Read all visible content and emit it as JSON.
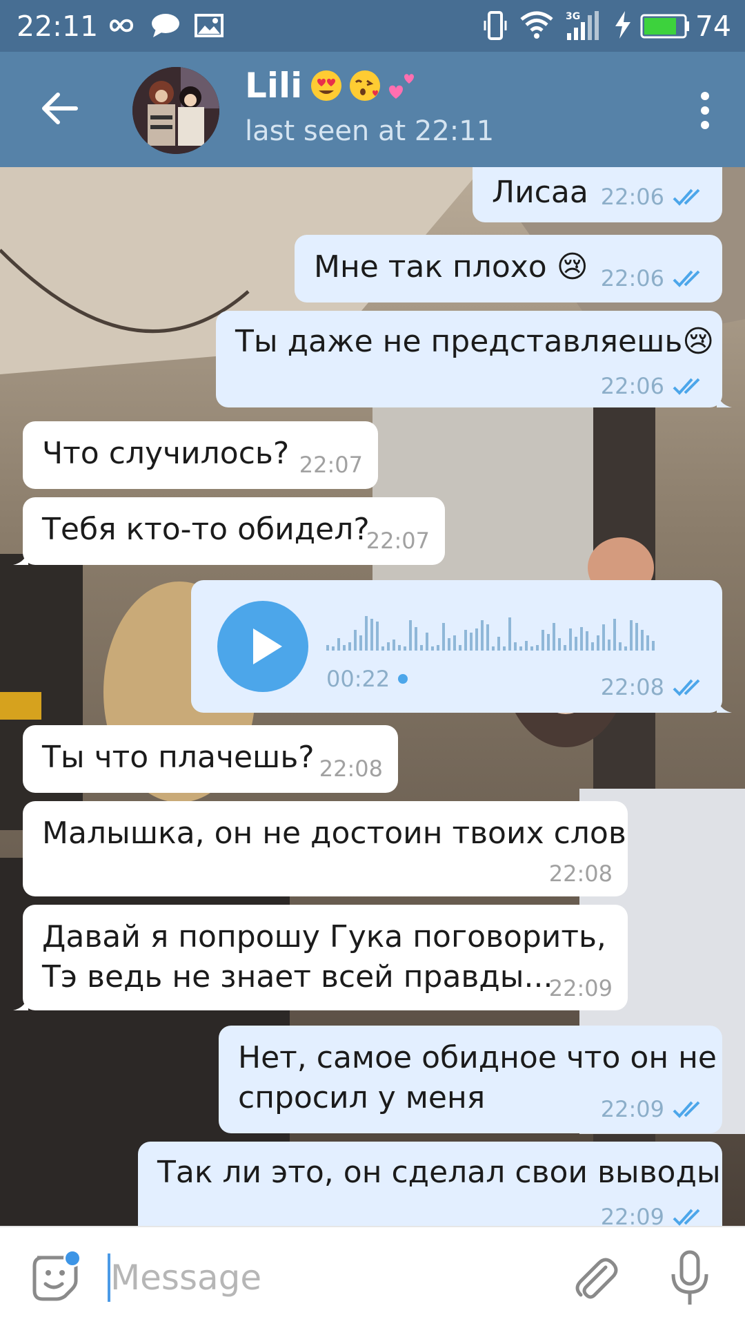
{
  "status_bar": {
    "time": "22:11",
    "battery": "74",
    "network": "3G"
  },
  "header": {
    "name": "Lili",
    "name_emojis": "😍😘💕",
    "status": "last seen at 22:11"
  },
  "messages": [
    {
      "dir": "out",
      "text": "Лисаа",
      "time": "22:06",
      "read": true
    },
    {
      "dir": "out",
      "text": "Мне так плохо 😢",
      "time": "22:06",
      "read": true
    },
    {
      "dir": "out",
      "text": "Ты даже не представляешь😢",
      "time": "22:06",
      "read": true
    },
    {
      "dir": "in",
      "text": "Что случилось?",
      "time": "22:07"
    },
    {
      "dir": "in",
      "text": "Тебя кто-то обидел?",
      "time": "22:07"
    },
    {
      "dir": "out",
      "type": "voice",
      "duration": "00:22",
      "time": "22:08",
      "read": true
    },
    {
      "dir": "in",
      "text": "Ты что плачешь?",
      "time": "22:08"
    },
    {
      "dir": "in",
      "text": "Малышка, он не достоин твоих слов",
      "time": "22:08"
    },
    {
      "dir": "in",
      "lines": [
        "Давай я попрошу Гука поговорить,",
        "Тэ ведь не знает всей правды..."
      ],
      "time": "22:09"
    },
    {
      "dir": "out",
      "lines": [
        "Нет, самое обидное что он не",
        "спросил у меня"
      ],
      "time": "22:09",
      "read": true
    },
    {
      "dir": "out",
      "text": "Так ли это, он сделал свои выводы",
      "time": "22:09",
      "read": true
    }
  ],
  "input": {
    "placeholder": "Message"
  },
  "colors": {
    "header": "#5682a8",
    "status_bar": "#476e93",
    "bubble_out": "#e3efff",
    "bubble_in": "#ffffff",
    "accent": "#4ca6ea"
  }
}
